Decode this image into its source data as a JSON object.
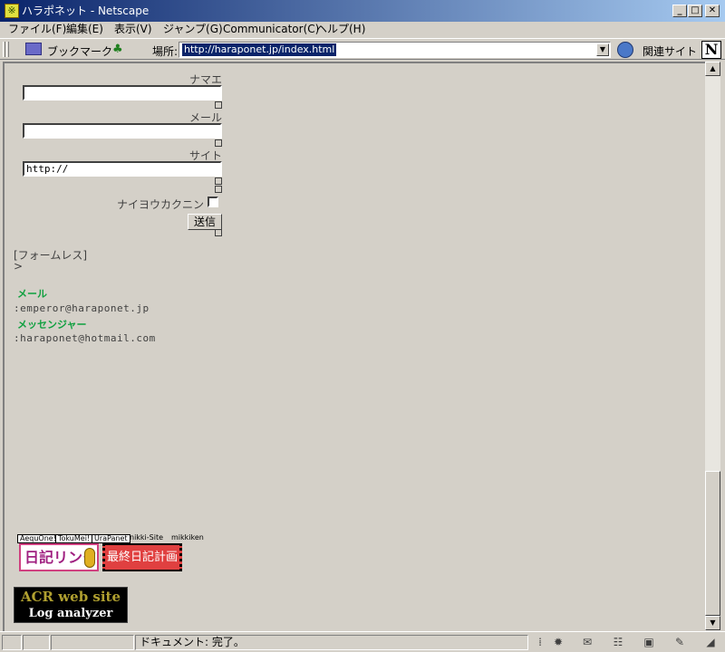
{
  "window": {
    "title": "ハラポネット - Netscape"
  },
  "menu": [
    "ファイル(F)",
    "編集(E)",
    "表示(V)",
    "ジャンプ(G)",
    "Communicator(C)",
    "ヘルプ(H)"
  ],
  "locbar": {
    "bookmarks_label": "ブックマーク",
    "location_label": "場所:",
    "url": "http://haraponet.jp/index.html",
    "related_label": "関連サイト"
  },
  "form": {
    "name_label": "ナマエ",
    "mail_label": "メール",
    "site_label": "サイト",
    "site_value": "http://",
    "private_label": "ナイヨウカクニン",
    "submit_label": "送信"
  },
  "page": {
    "formless": "[フォームレス]",
    "gt": ">",
    "mail_heading": "メール",
    "mail_value": ":emperor@haraponet.jp",
    "messenger_heading": "メッセンジャー",
    "messenger_value": ":haraponet@hotmail.com",
    "badges": [
      "AequOne!",
      "TokuMei!",
      "UraPanet",
      "nikki-Site",
      "mikkiken"
    ],
    "banner_link": "日記リンク",
    "banner_final": "最終日記計画",
    "acr_line1": "ACR web site",
    "acr_line2": "Log analyzer"
  },
  "status": {
    "text": "ドキュメント: 完了。"
  }
}
